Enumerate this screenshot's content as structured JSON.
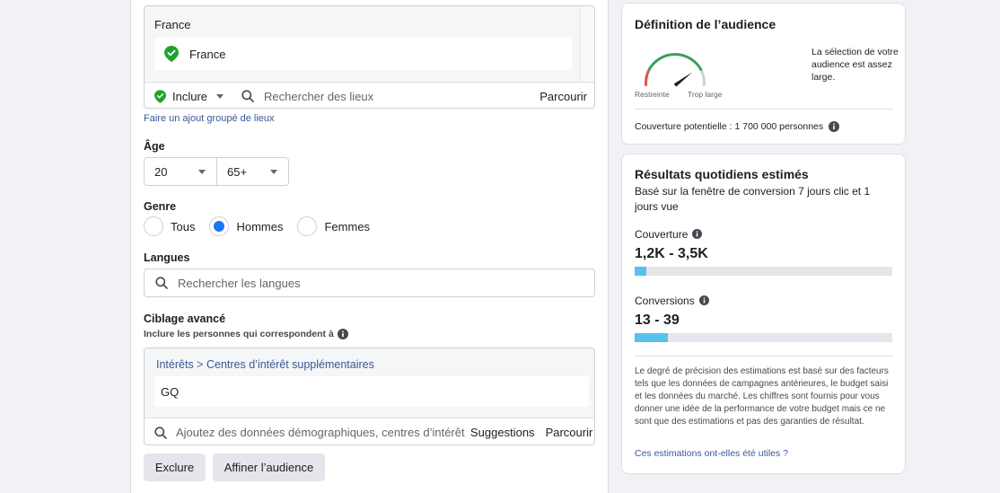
{
  "location": {
    "country_header": "France",
    "selected_chip": "France",
    "include_label": "Inclure",
    "search_placeholder": "Rechercher des lieux",
    "browse_label": "Parcourir",
    "bulk_link": "Faire un ajout groupé de lieux"
  },
  "age": {
    "label": "Âge",
    "min": "20",
    "max": "65+"
  },
  "gender": {
    "label": "Genre",
    "options": [
      "Tous",
      "Hommes",
      "Femmes"
    ],
    "selected": "Hommes"
  },
  "languages": {
    "label": "Langues",
    "placeholder": "Rechercher les langues"
  },
  "advanced": {
    "label": "Ciblage avancé",
    "sublabel": "Inclure les personnes qui correspondent à",
    "crumb_part1": "Intérêts",
    "crumb_sep": ">",
    "crumb_part2": "Centres d’intérêt supplémentaires",
    "interest_chip": "GQ",
    "search_placeholder": "Ajoutez des données démographiques, centres d’intérêt ou comportements",
    "suggestions_label": "Suggestions",
    "browse_label": "Parcourir"
  },
  "buttons": {
    "exclude": "Exclure",
    "refine": "Affiner l’audience"
  },
  "audience_card": {
    "title": "Définition de l’audience",
    "gauge_min_label": "Restreinte",
    "gauge_max_label": "Trop large",
    "gauge_level": 0.72,
    "description": "La sélection de votre audience est assez large.",
    "potential_reach": "Couverture potentielle : 1 700 000 personnes"
  },
  "results_card": {
    "title": "Résultats quotidiens estimés",
    "subtitle": "Basé sur la fenêtre de conversion 7 jours clic et 1 jours vue",
    "reach_label": "Couverture",
    "reach_value": "1,2K - 3,5K",
    "reach_fill": 0.045,
    "conversions_label": "Conversions",
    "conversions_value": "13 - 39",
    "conversions_fill": 0.13,
    "disclaimer": "Le degré de précision des estimations est basé sur des facteurs tels que les données de campagnes antérieures, le budget saisi et les données du marché. Les chiffres sont fournis pour vous donner une idée de la performance de votre budget mais ce ne sont que des estimations et pas des garanties de résultat.",
    "feedback_link": "Ces estimations ont-elles été utiles ?"
  },
  "colors": {
    "accent_blue": "#1877f2",
    "link_blue": "#385898",
    "bar_fill": "#56c2eb",
    "check_green": "#1fa32d",
    "gauge_red": "#d9534f",
    "gauge_green": "#3a9d5d"
  }
}
